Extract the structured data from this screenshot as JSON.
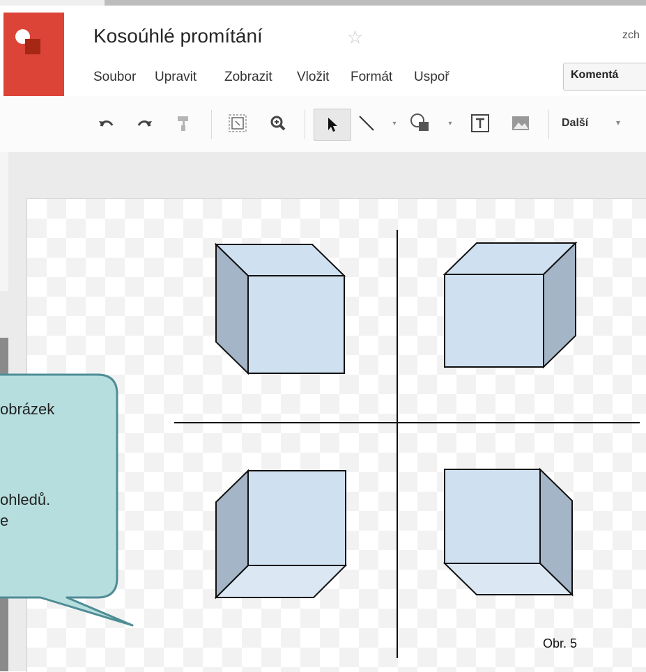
{
  "document": {
    "title": "Kosoúhlé promítání",
    "user": "zch"
  },
  "menu": [
    "Soubor",
    "Upravit",
    "Zobrazit",
    "Vložit",
    "Formát",
    "Uspoř"
  ],
  "comments_button": "Komentá",
  "toolbar": {
    "icons": [
      "undo-icon",
      "redo-icon",
      "paint-format-icon",
      "zoom-fit-icon",
      "zoom-icon",
      "select-icon",
      "line-icon",
      "shape-icon",
      "text-box-icon",
      "image-icon"
    ],
    "more_label": "Další",
    "more_caret": "▾"
  },
  "callout": {
    "line1": "obrázek",
    "line2": "ohledů.",
    "line3": "e"
  },
  "figure": {
    "label": "Obr. 5"
  },
  "colors": {
    "brand_red": "#db4437",
    "cube_front": "#cfe0f1",
    "cube_side": "#a3b5c6",
    "callout_fill": "#b7dede",
    "callout_border": "#4f8d95"
  }
}
